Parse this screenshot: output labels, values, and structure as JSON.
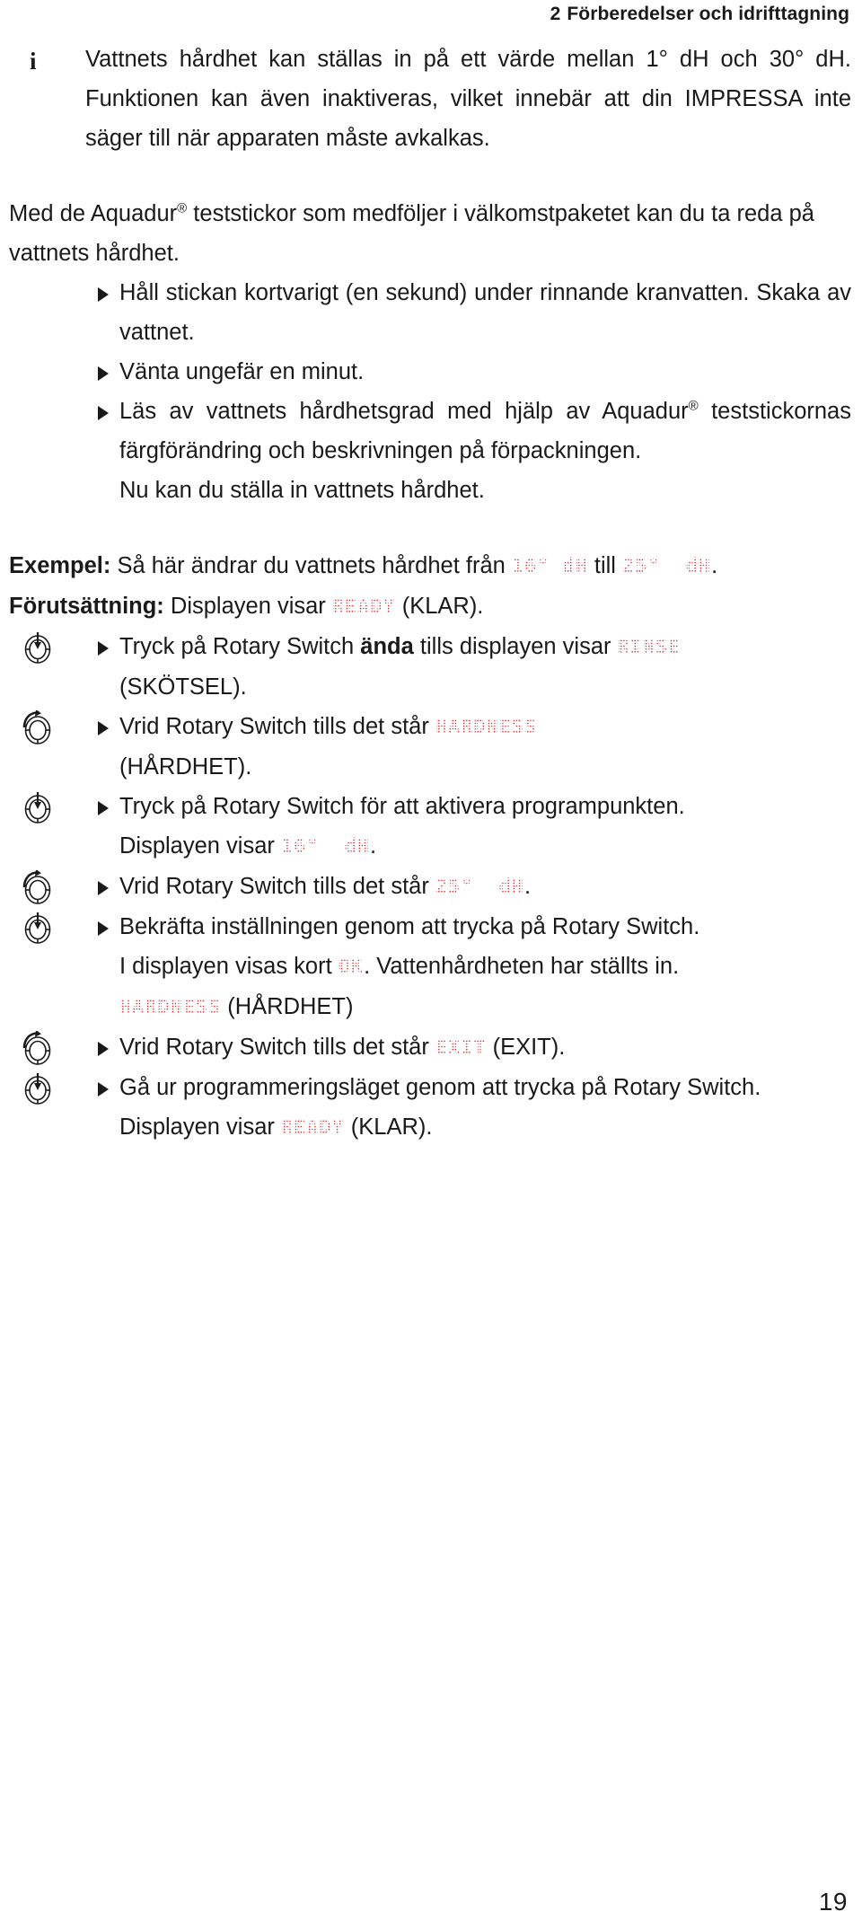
{
  "header": {
    "chapter_number": "2",
    "title": "Förberedelser och idrifttagning"
  },
  "info_note": {
    "icon": "info-icon",
    "text": "Vattnets hårdhet kan ställas in på ett värde mellan 1° dH och 30° dH. Funktionen kan även inaktiveras, vilket innebär att din IMPRESSA inte säger till när apparaten måste avkalkas."
  },
  "intro": {
    "text_before": "Med de Aquadur",
    "registered_mark": "®",
    "text_after": " teststickor som medföljer i välkomstpaketet kan du ta reda på vattnets hårdhet."
  },
  "steps_test": [
    {
      "text": "Håll stickan kortvarigt (en sekund) under rinnande kranvatten. Skaka av vattnet."
    },
    {
      "text": "Vänta ungefär en minut."
    },
    {
      "text_before": "Läs av vattnets hårdhetsgrad med hjälp av Aquadur",
      "registered_mark": "®",
      "text_after": " teststickornas färgförändring och beskrivningen på förpackningen."
    }
  ],
  "after_test_note": "Nu kan du ställa in vattnets hårdhet.",
  "example": {
    "label": "Exempel:",
    "text_1": " Så här ändrar du vattnets hårdhet från ",
    "led_1": "16° dH",
    "text_2": " till ",
    "led_2": "25°  dH",
    "text_3": "."
  },
  "precondition": {
    "label": "Förutsättning:",
    "text_1": " Displayen visar ",
    "led_1": "READY",
    "text_2": " (KLAR)."
  },
  "procedure": [
    {
      "icon": "rotary-switch-press-icon",
      "text_1": "Tryck på Rotary Switch ",
      "emphasis": "ända",
      "text_2": " tills displayen visar ",
      "led_1": "RINSE",
      "continuation": "(SKÖTSEL)."
    },
    {
      "icon": "rotary-switch-turn-icon",
      "text_1": "Vrid Rotary Switch tills det står ",
      "led_1": "HARDNESS",
      "continuation": "(HÅRDHET)."
    },
    {
      "icon": "rotary-switch-press-icon",
      "text_1": "Tryck på Rotary Switch för att aktivera programpunkten.",
      "sub_text_1": "Displayen visar ",
      "sub_led_1": "16°  dH",
      "sub_text_2": "."
    },
    {
      "icon": "rotary-switch-turn-icon",
      "text_1": "Vrid Rotary Switch tills det står ",
      "led_1": "25°  dH",
      "text_2": "."
    },
    {
      "icon": "rotary-switch-press-icon",
      "text_1": "Bekräfta inställningen genom att trycka på Rotary Switch.",
      "sub_text_1": "I displayen visas kort ",
      "sub_led_1": "OK",
      "sub_text_2": ". Vattenhårdheten har ställts in.",
      "sub_led_2": "HARDNESS",
      "sub_text_3": " (HÅRDHET)"
    },
    {
      "icon": "rotary-switch-turn-icon",
      "text_1": "Vrid Rotary Switch tills det står ",
      "led_1": "EXIT",
      "text_2": " (EXIT)."
    },
    {
      "icon": "rotary-switch-press-icon",
      "text_1": "Gå ur programmeringsläget genom att trycka på Rotary Switch.",
      "sub_text_1": "Displayen visar ",
      "sub_led_1": "READY",
      "sub_text_2": " (KLAR)."
    }
  ],
  "folio": "19",
  "colors": {
    "led_red": "#d12b2f",
    "text_black": "#1a1a1a"
  }
}
